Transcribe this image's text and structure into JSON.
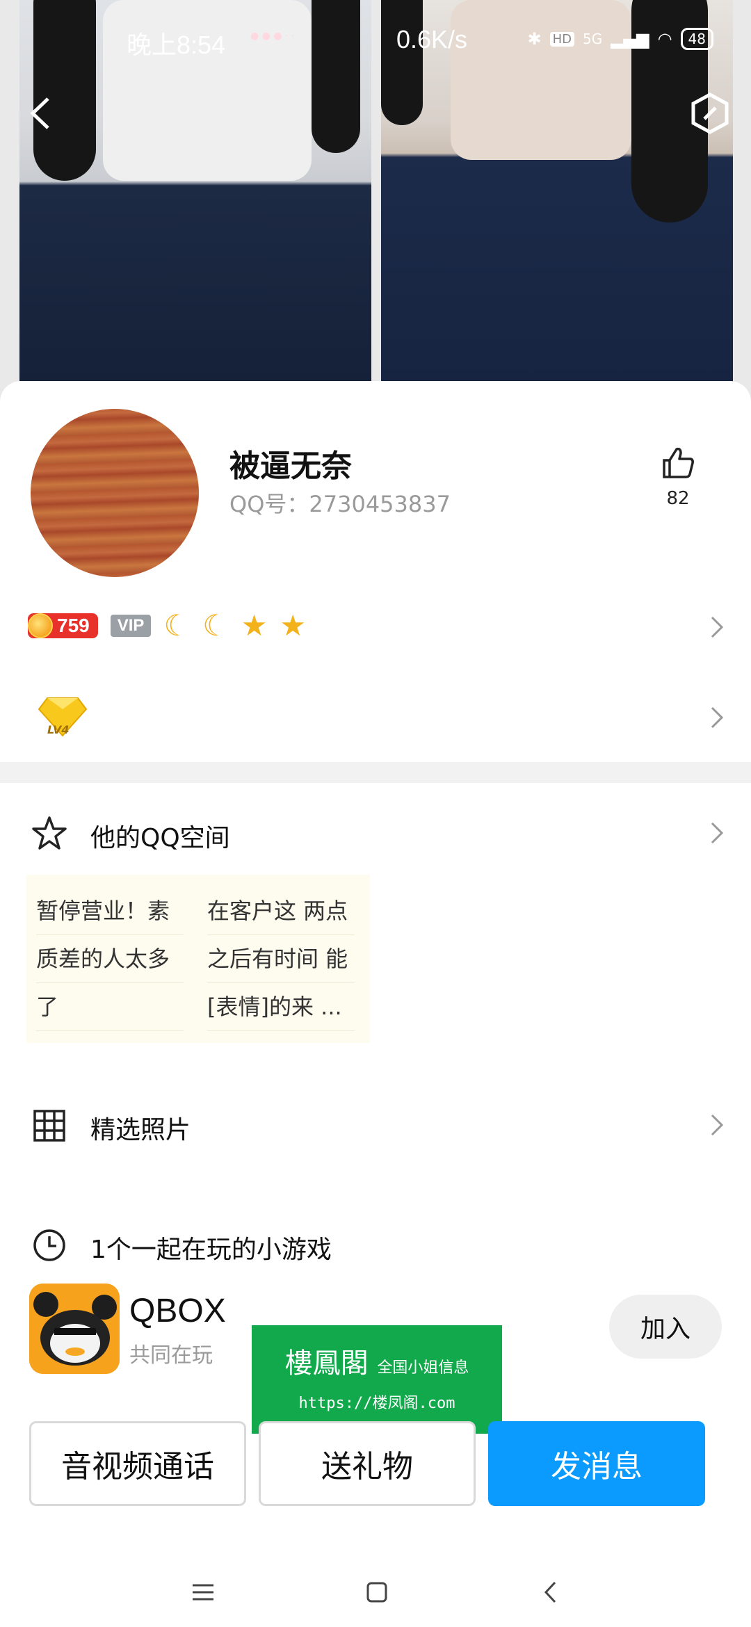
{
  "status_bar": {
    "time": "晚上8:54",
    "dots": "● ● ● · ·",
    "net_speed": "0.6K/s",
    "hd": "HD",
    "network": "5G",
    "battery": "48"
  },
  "profile": {
    "nickname": "被逼无奈",
    "qq_number": "QQ号：2730453837",
    "like_count": "82",
    "level": "759",
    "vip_label": "VIP",
    "level_icons": [
      "moon-icon",
      "moon-icon",
      "star-icon",
      "star-icon"
    ],
    "diamond_level": "LV4"
  },
  "qzone": {
    "title": "他的QQ空间",
    "posts": [
      [
        "暂停营业！素",
        "质差的人太多",
        "了"
      ],
      [
        "在客户这 两点",
        "之后有时间 能",
        "[表情]的来 ..."
      ]
    ]
  },
  "photos": {
    "title": "精选照片"
  },
  "games": {
    "title": "1个一起在玩的小游戏",
    "game_name": "QBOX",
    "game_sub": "共同在玩",
    "join_label": "加入"
  },
  "watermark": {
    "title": "樓鳳閣",
    "subtitle": "全国小姐信息",
    "url": "https://楼凤阁.com"
  },
  "actions": {
    "call_label": "音视频通话",
    "gift_label": "送礼物",
    "message_label": "发消息"
  },
  "colors": {
    "primary_blue": "#0b9bff",
    "watermark_green": "#11a94b",
    "level_red": "#e8312a"
  }
}
